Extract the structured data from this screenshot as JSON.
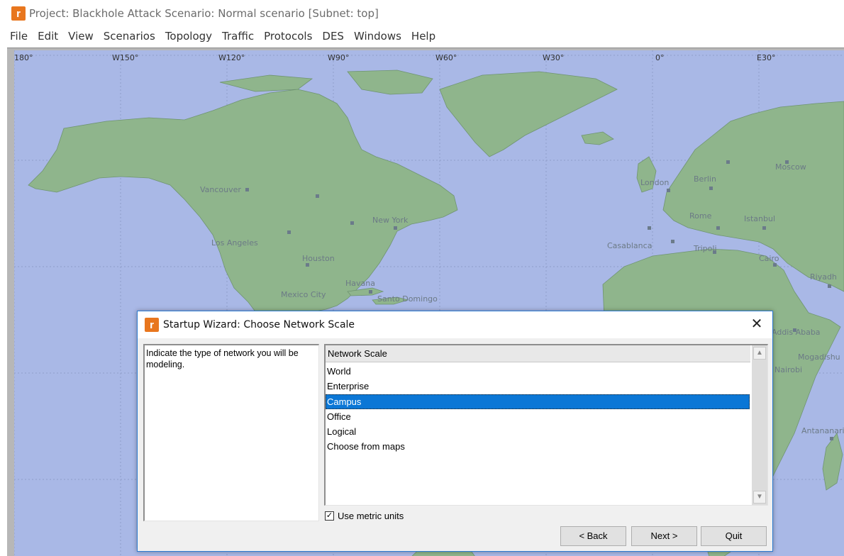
{
  "window": {
    "title": "Project: Blackhole Attack Scenario: Normal scenario  [Subnet: top]",
    "logo_glyph": "r"
  },
  "menu": [
    "File",
    "Edit",
    "View",
    "Scenarios",
    "Topology",
    "Traffic",
    "Protocols",
    "DES",
    "Windows",
    "Help"
  ],
  "map": {
    "ocean_color": "#a9b8e6",
    "land_color": "#8fb58c",
    "longitude_labels": [
      "180°",
      "W150°",
      "W120°",
      "W90°",
      "W60°",
      "W30°",
      "0°",
      "E30°"
    ],
    "city_labels": [
      "Vancouver",
      "Los Angeles",
      "Houston",
      "New York",
      "Mexico City",
      "Havana",
      "Santo Domingo",
      "London",
      "Berlin",
      "Moscow",
      "Rome",
      "Istanbul",
      "Casablanca",
      "Tripoli",
      "Cairo",
      "Riyadh",
      "Addis Ababa",
      "Mogadishu",
      "Nairobi",
      "Antananarivo"
    ]
  },
  "dialog": {
    "title": "Startup Wizard: Choose Network Scale",
    "close_icon": "close-icon",
    "description": "Indicate the type of network you will be modeling.",
    "list_header": "Network Scale",
    "items": [
      "World",
      "Enterprise",
      "Campus",
      "Office",
      "Logical",
      "Choose from maps"
    ],
    "selected_item": "Campus",
    "metric_units_label": "Use metric units",
    "metric_units_checked": true,
    "buttons": {
      "back": "< Back",
      "next": "Next >",
      "quit": "Quit"
    },
    "accent_color": "#0b77d6"
  }
}
